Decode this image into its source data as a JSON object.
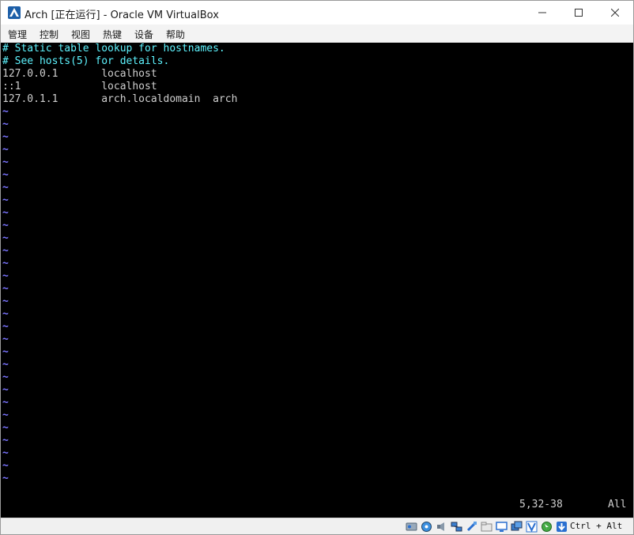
{
  "window": {
    "title": "Arch [正在运行] - Oracle VM VirtualBox",
    "icon": "virtualbox-icon"
  },
  "menu": [
    {
      "label": "管理"
    },
    {
      "label": "控制"
    },
    {
      "label": "视图"
    },
    {
      "label": "热键"
    },
    {
      "label": "设备"
    },
    {
      "label": "帮助"
    }
  ],
  "terminal": {
    "lines": [
      {
        "text": "# Static table lookup for hostnames.",
        "style": "comment"
      },
      {
        "text": "# See hosts(5) for details.",
        "style": "comment"
      },
      {
        "text": "127.0.0.1       localhost",
        "style": "plain"
      },
      {
        "text": "::1             localhost",
        "style": "plain"
      },
      {
        "text": "127.0.1.1       arch.localdomain  arch",
        "style": "plain"
      }
    ],
    "empty_line_marker": "~",
    "empty_line_count": 30,
    "status_position": "5,32-38",
    "status_scope": "All"
  },
  "statusbar": {
    "icons": [
      "hard-disk-icon",
      "optical-disk-icon",
      "audio-icon",
      "network-icon",
      "usb-icon",
      "shared-folders-icon",
      "display-icon",
      "video-capture-icon",
      "virtualization-icon",
      "mouse-integration-icon",
      "keyboard-icon"
    ],
    "host_key": "Ctrl + Alt"
  },
  "colors": {
    "comment": "#5ef4ff",
    "plain": "#cfcfcf",
    "tilde": "#7a74ff",
    "screen_bg": "#000000"
  }
}
